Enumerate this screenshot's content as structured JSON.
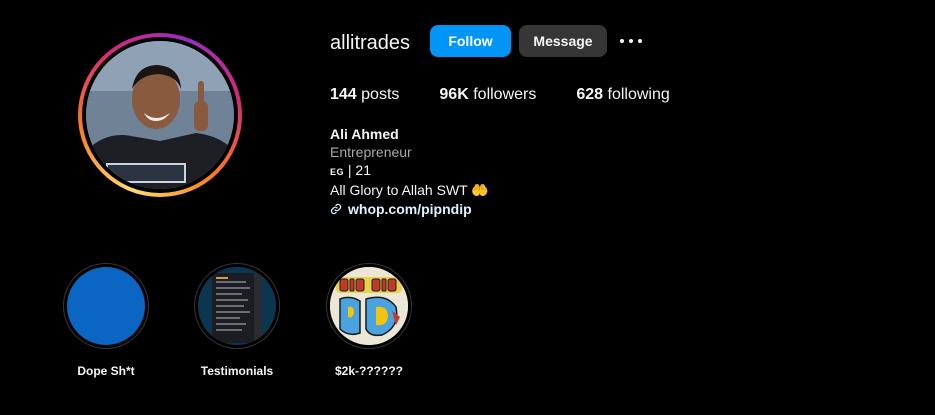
{
  "profile": {
    "username": "allitrades",
    "follow_label": "Follow",
    "message_label": "Message",
    "more_icon": "more-options-icon"
  },
  "stats": {
    "posts_count": "144",
    "posts_label": "posts",
    "followers_count": "96K",
    "followers_label": "followers",
    "following_count": "628",
    "following_label": "following"
  },
  "bio": {
    "full_name": "Ali Ahmed",
    "category": "Entrepreneur",
    "flag_code": "EG",
    "line1_rest": "| 21",
    "line2": "All Glory to Allah SWT",
    "line2_emoji": "🤲",
    "link": "whop.com/pipndip"
  },
  "highlights": [
    {
      "label": "Dope Sh*t",
      "cover": "solid-blue"
    },
    {
      "label": "Testimonials",
      "cover": "screenshot"
    },
    {
      "label": "$2k-??????",
      "cover": "graffiti"
    }
  ],
  "colors": {
    "background": "#000000",
    "follow_button": "#0095f6",
    "message_button": "#363636",
    "link": "#e0f1ff",
    "secondary_text": "#a8a8a8"
  }
}
